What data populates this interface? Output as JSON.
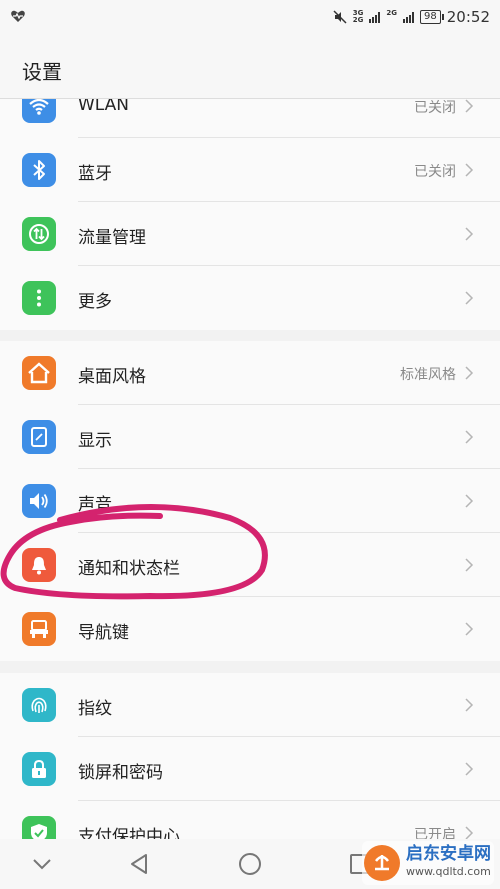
{
  "colors": {
    "wlan": "#3e8ee6",
    "bluetooth": "#3e8ee6",
    "data_usage": "#3ec35a",
    "more": "#3ec35a",
    "home_style": "#f07a2a",
    "display": "#3e8ee6",
    "sound": "#3e8ee6",
    "notification": "#ef5a3c",
    "nav_key": "#f07a2a",
    "fingerprint": "#2fb7c9",
    "lock": "#2fb7c9",
    "payment": "#3ec35a",
    "annotation": "#d4236e"
  },
  "status_bar": {
    "left_icon": "heart-pulse-icon",
    "network_top": "3G",
    "network_bottom": "2G",
    "network2": "2G",
    "battery": "98",
    "time": "20:52"
  },
  "title": "设置",
  "groups": [
    {
      "items": [
        {
          "label": "WLAN",
          "value": "已关闭",
          "icon": "wifi-icon"
        },
        {
          "label": "蓝牙",
          "value": "已关闭",
          "icon": "bluetooth-icon"
        },
        {
          "label": "流量管理",
          "value": "",
          "icon": "data-usage-icon"
        },
        {
          "label": "更多",
          "value": "",
          "icon": "more-icon"
        }
      ]
    },
    {
      "items": [
        {
          "label": "桌面风格",
          "value": "标准风格",
          "icon": "home-icon"
        },
        {
          "label": "显示",
          "value": "",
          "icon": "display-icon"
        },
        {
          "label": "声音",
          "value": "",
          "icon": "speaker-icon"
        },
        {
          "label": "通知和状态栏",
          "value": "",
          "icon": "bell-icon"
        },
        {
          "label": "导航键",
          "value": "",
          "icon": "nav-key-icon"
        }
      ]
    },
    {
      "items": [
        {
          "label": "指纹",
          "value": "",
          "icon": "fingerprint-icon"
        },
        {
          "label": "锁屏和密码",
          "value": "",
          "icon": "lock-icon"
        },
        {
          "label": "支付保护中心",
          "value": "已开启",
          "icon": "shield-check-icon"
        }
      ]
    }
  ],
  "navbar": {
    "back": "triangle-back-icon",
    "home": "circle-home-icon",
    "recent": "square-recent-icon",
    "down": "chevron-down-icon"
  },
  "watermark": {
    "line1": "启东安卓网",
    "line2": "www.qdltd.com"
  }
}
